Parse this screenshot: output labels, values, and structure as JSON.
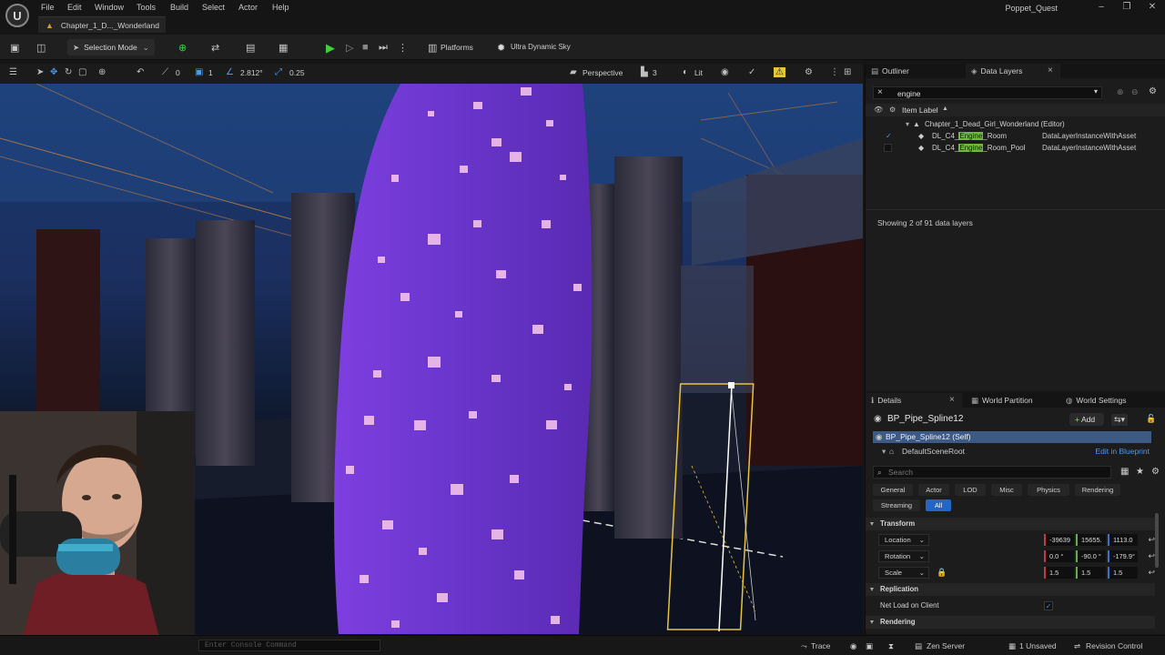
{
  "app": {
    "logo_letter": "U",
    "project_name": "Poppet_Quest",
    "menu": [
      "File",
      "Edit",
      "Window",
      "Tools",
      "Build",
      "Select",
      "Actor",
      "Help"
    ],
    "level_tab": "Chapter_1_D..._Wonderland"
  },
  "toolbar": {
    "selection_mode": "Selection Mode",
    "platforms": "Platforms",
    "sky": "Ultra Dynamic Sky"
  },
  "viewport_toolbar": {
    "rotation_snap": "0",
    "grid_count": "1",
    "angle": "2.812°",
    "scale_snap": "0.25",
    "perspective": "Perspective",
    "cam_speed": "3",
    "lit": "Lit"
  },
  "outliner": {
    "tab_outliner": "Outliner",
    "tab_data_layers": "Data Layers",
    "filter_text": "engine",
    "column_header": "Item Label",
    "world_row": "Chapter_1_Dead_Girl_Wonderland (Editor)",
    "rows": [
      {
        "prefix": "DL_C4_",
        "highlight": "Engine",
        "suffix": "_Room",
        "type": "DataLayerInstanceWithAsset",
        "checked": true
      },
      {
        "prefix": "DL_C4_",
        "highlight": "Engine",
        "suffix": "_Room_Pool",
        "type": "DataLayerInstanceWithAsset",
        "checked": false
      }
    ],
    "showing": "Showing 2 of 91 data layers"
  },
  "details": {
    "tab_details": "Details",
    "tab_world_partition": "World Partition",
    "tab_world_settings": "World Settings",
    "actor_name": "BP_Pipe_Spline12",
    "add_label": "Add",
    "self_row": "BP_Pipe_Spline12 (Self)",
    "root_row": "DefaultSceneRoot",
    "edit_in_blueprint": "Edit in Blueprint",
    "search_placeholder": "Search",
    "categories": [
      "General",
      "Actor",
      "LOD",
      "Misc",
      "Physics",
      "Rendering",
      "Streaming",
      "All"
    ],
    "transform_header": "Transform",
    "location_label": "Location",
    "location": [
      "-39639",
      "15655.",
      "1113.0"
    ],
    "rotation_label": "Rotation",
    "rotation": [
      "0.0 °",
      "-90.0 °",
      "-179.9°"
    ],
    "scale_label": "Scale",
    "scale": [
      "1.5",
      "1.5",
      "1.5"
    ],
    "replication_header": "Replication",
    "net_load_label": "Net Load on Client",
    "rendering_header": "Rendering"
  },
  "statusbar": {
    "console_placeholder": "Enter Console Command",
    "trace": "Trace",
    "zen_server": "Zen Server",
    "unsaved": "1 Unsaved",
    "revision_control": "Revision Control"
  },
  "colors": {
    "accent_blue": "#2366c6",
    "highlight_green": "#6fb93d",
    "play_green": "#3fcf3f",
    "selection_yellow": "#e8c43a",
    "figure_purple": "#6a3ad0"
  }
}
